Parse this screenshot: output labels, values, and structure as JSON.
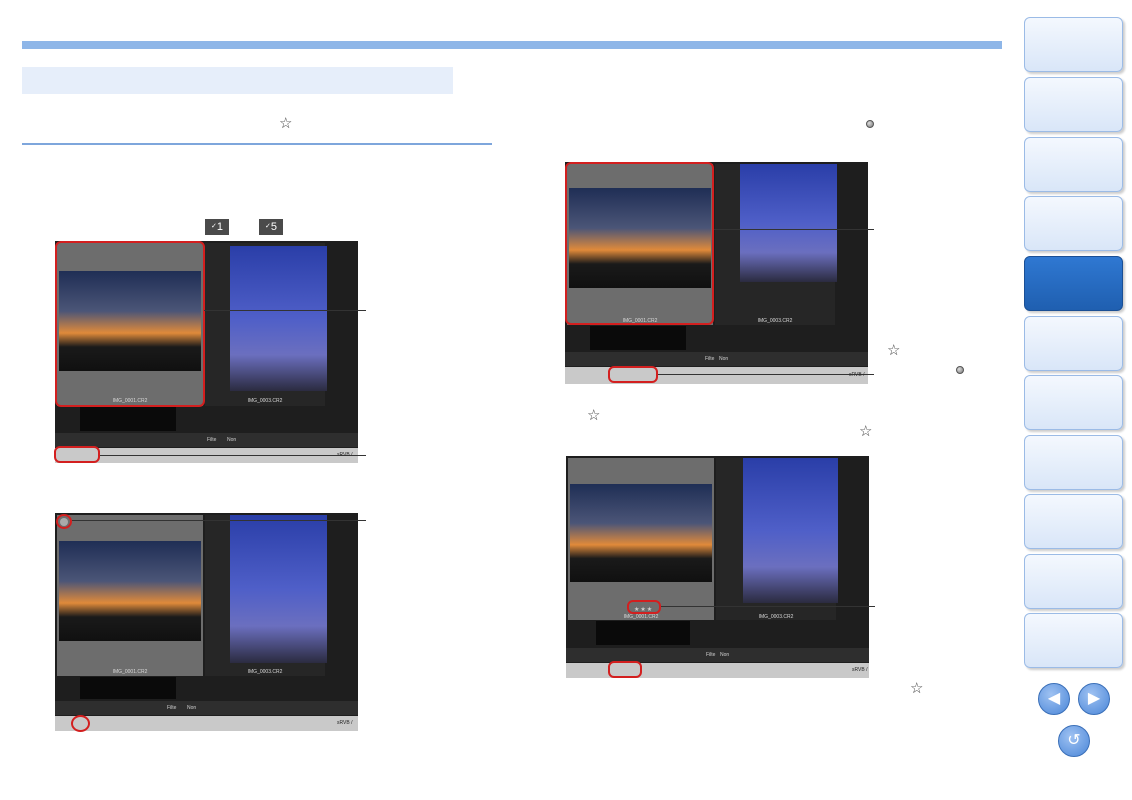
{
  "keys": {
    "key1": "1",
    "key5": "5"
  },
  "screens": {
    "s1": {
      "file1": "IMG_0001.CR2",
      "file2": "IMG_0003.CR2",
      "filter": "Filte",
      "non": "Non",
      "srgb": "sRVB /"
    },
    "s2": {
      "file1": "IMG_0001.CR2",
      "file2": "IMG_0003.CR2",
      "filter": "Filte",
      "non": "Non",
      "srgb": "sRVB /"
    },
    "s3": {
      "file1": "IMG_0001.CR2",
      "file2": "IMG_0003.CR2",
      "filter": "Filte",
      "non": "Non",
      "srgb": "sRVB /"
    },
    "s4": {
      "file1": "IMG_0001.CR2",
      "file2": "IMG_0003.CR2",
      "filter": "Filte",
      "non": "Non",
      "srgb": "sRVB /",
      "stars": "★★★"
    }
  },
  "icons": {
    "star": "star-outline-icon",
    "dot": "rating-dot-icon",
    "prev": "arrow-left-icon",
    "next": "arrow-right-icon",
    "back": "return-icon"
  },
  "colors": {
    "accent": "#8eb6e8",
    "highlight": "#d31f1f",
    "nav_active": "#2f78d2"
  },
  "nav": {
    "button_count": 11,
    "active_index": 4
  }
}
